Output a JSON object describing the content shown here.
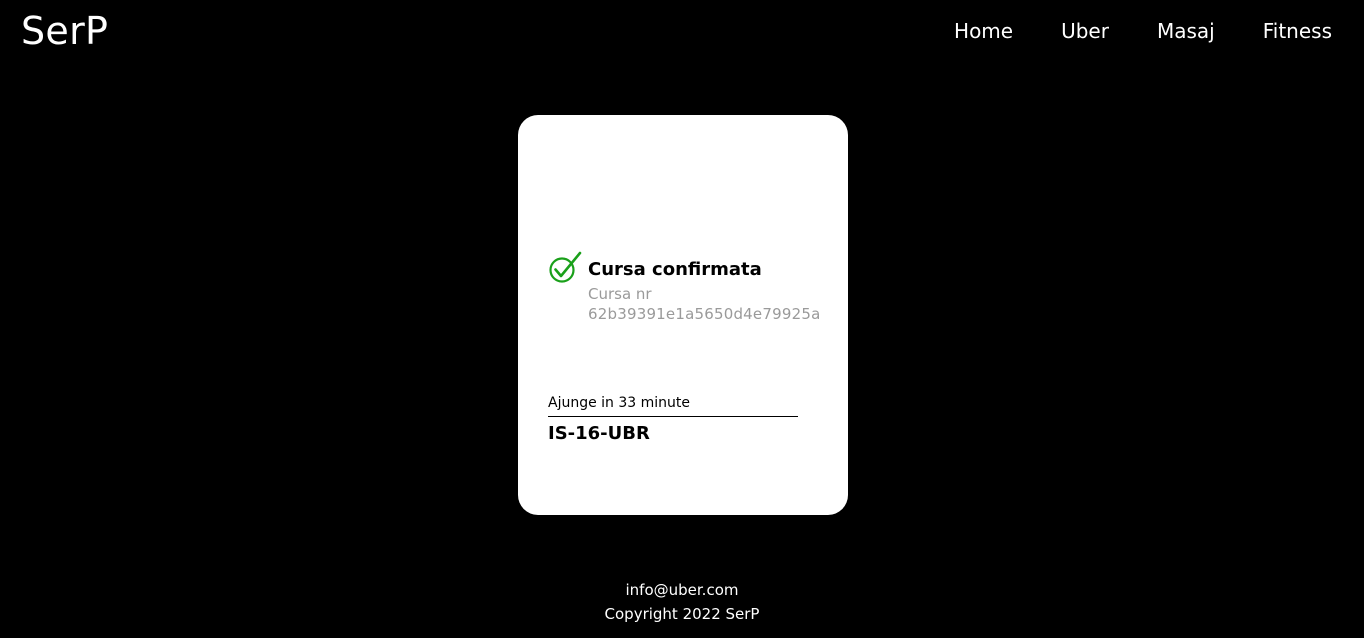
{
  "header": {
    "logo": "SerP",
    "nav": [
      {
        "label": "Home"
      },
      {
        "label": "Uber"
      },
      {
        "label": "Masaj"
      },
      {
        "label": "Fitness"
      }
    ]
  },
  "card": {
    "status_icon": "check-circle-icon",
    "status_color": "#1aa01a",
    "title": "Cursa confirmata",
    "ride_label": "Cursa nr",
    "ride_id": "62b39391e1a5650d4e79925a",
    "eta": "Ajunge in 33 minute",
    "plate": "IS-16-UBR"
  },
  "footer": {
    "email": "info@uber.com",
    "copyright": "Copyright 2022 SerP"
  }
}
